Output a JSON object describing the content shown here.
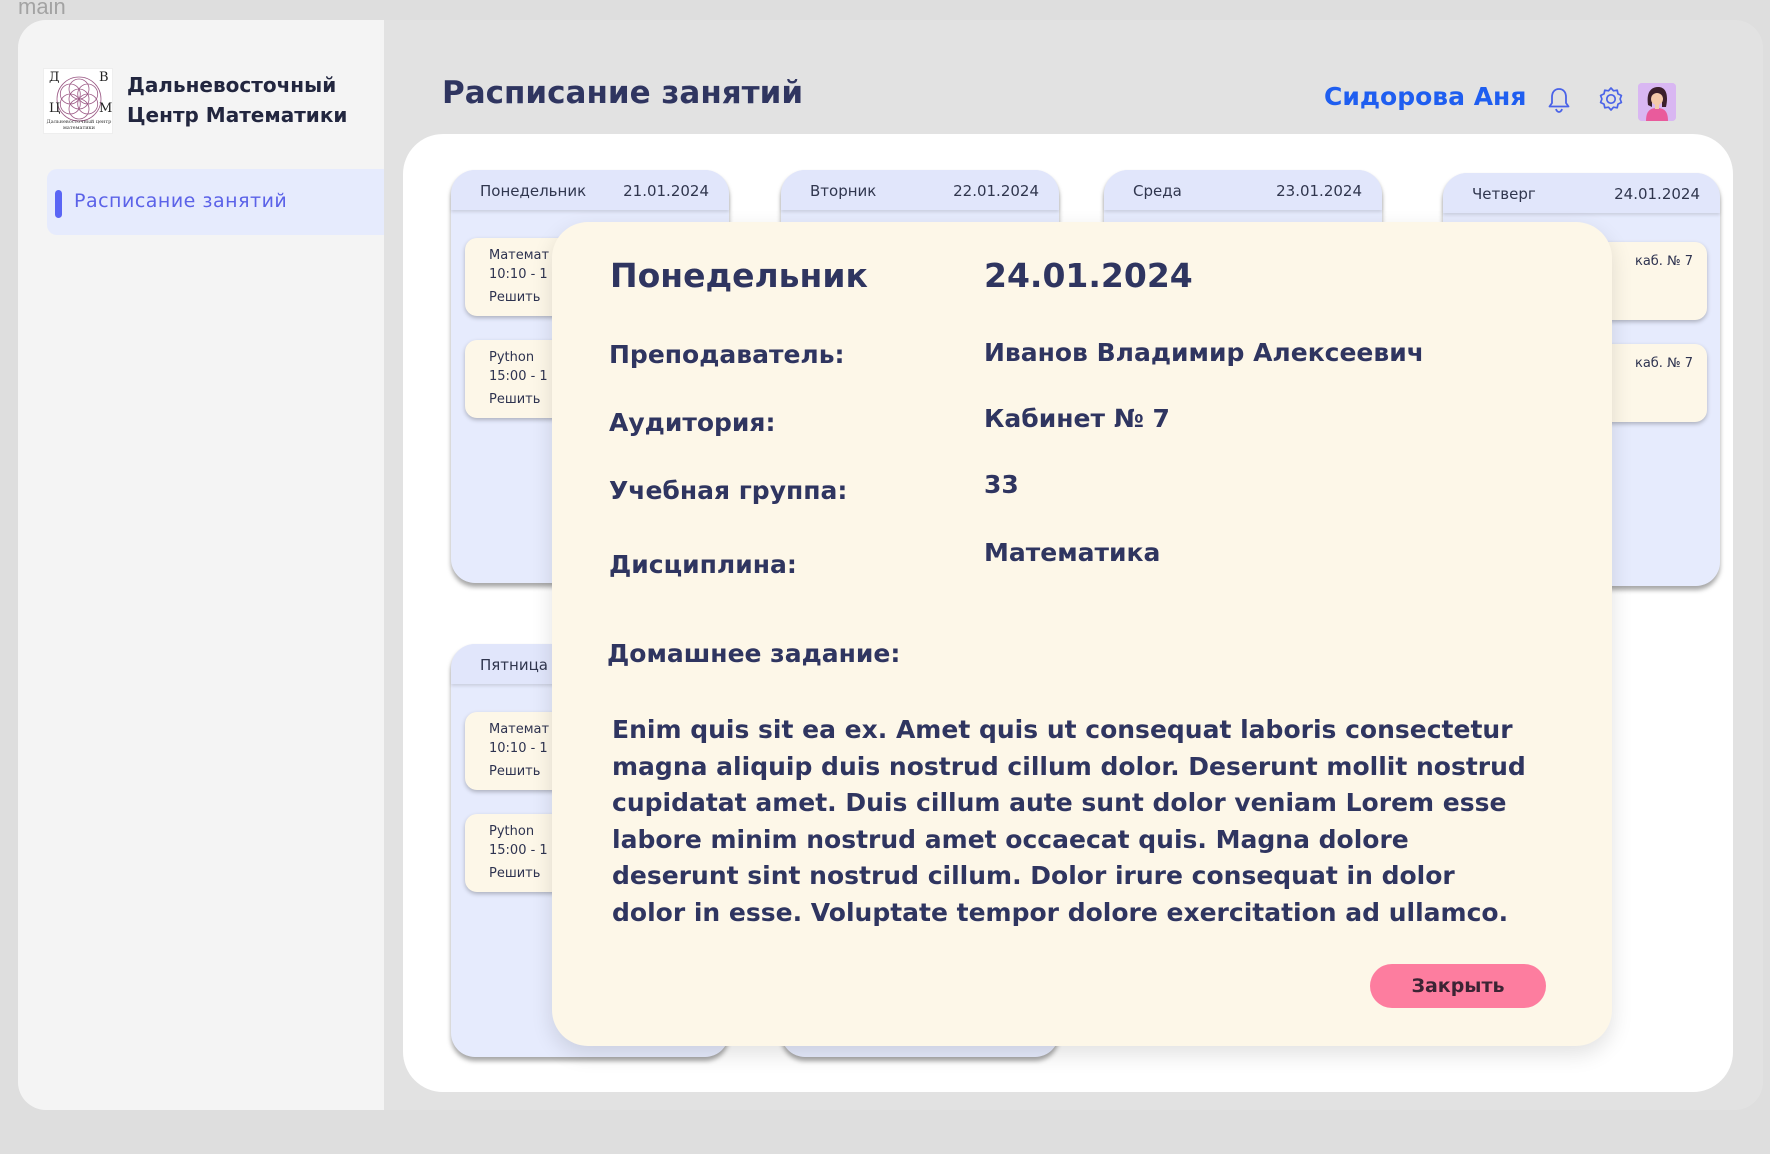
{
  "frame_label": "main",
  "brand": {
    "logo_letters": [
      "Д",
      "В",
      "Ц",
      "М"
    ],
    "logo_caption": "Дальневосточный центр математики",
    "name_line1": "Дальневосточный",
    "name_line2": "Центр Математики"
  },
  "sidebar": {
    "items": [
      {
        "label": "Расписание занятий",
        "active": true
      }
    ]
  },
  "header": {
    "title": "Расписание занятий",
    "user_name": "Сидорова Аня",
    "icons": [
      "bell-icon",
      "gear-icon",
      "avatar"
    ]
  },
  "days": [
    {
      "name": "Понедельник",
      "date": "21.01.2024",
      "lessons": [
        {
          "line1": "Математ",
          "line2": "10:10 - 1",
          "line3": "Решить"
        },
        {
          "line1": "Python",
          "line2": "15:00 - 1",
          "line3": "Решить"
        }
      ]
    },
    {
      "name": "Вторник",
      "date": "22.01.2024",
      "lessons": []
    },
    {
      "name": "Среда",
      "date": "23.01.2024",
      "lessons": []
    },
    {
      "name": "Четверг",
      "date": "24.01.2024",
      "lessons": [
        {
          "room": "каб. № 7",
          "dots": "..."
        },
        {
          "room": "каб. № 7",
          "dots": "..."
        }
      ]
    },
    {
      "name": "Пятница",
      "date": "",
      "lessons": [
        {
          "line1": "Математ",
          "line2": "10:10 - 1",
          "line3": "Решить"
        },
        {
          "line1": "Python",
          "line2": "15:00 - 1",
          "line3": "Решить"
        }
      ]
    }
  ],
  "modal": {
    "day": "Понедельник",
    "date": "24.01.2024",
    "teacher_label": "Преподаватель:",
    "teacher_value": "Иванов Владимир Алексеевич",
    "room_label": "Аудитория:",
    "room_value": "Кабинет № 7",
    "group_label": "Учебная группа:",
    "group_value": "33",
    "subject_label": "Дисциплина:",
    "subject_value": "Математика",
    "homework_label": "Домашнее задание:",
    "homework_text": "Enim quis sit ea ex. Amet quis ut consequat laboris consectetur magna aliquip duis nostrud cillum dolor. Deserunt mollit nostrud cupidatat amet. Duis cillum aute sunt dolor veniam Lorem esse labore minim nostrud amet occaecat quis. Magna dolore deserunt sint nostrud cillum. Dolor irure consequat in dolor dolor in esse. Voluptate tempor dolore exercitation ad ullamco.",
    "close_label": "Закрыть"
  },
  "colors": {
    "accent_blue": "#1f5ef0",
    "nav_accent": "#5a65f5",
    "title_text": "#2f3560",
    "card_bg": "#e6ebfd",
    "modal_bg": "#fdf7e8",
    "close_button": "#fd7d9f"
  }
}
